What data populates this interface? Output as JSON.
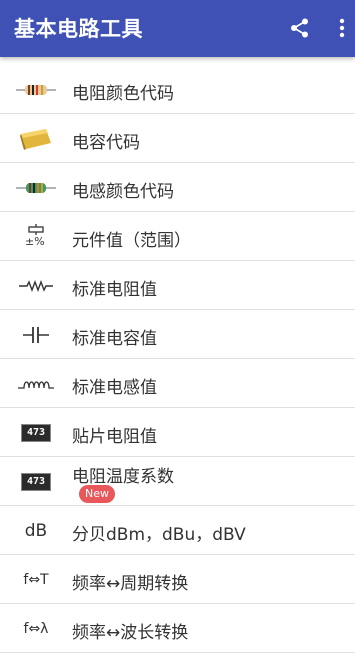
{
  "appbar": {
    "title": "基本电路工具",
    "share_icon": "share-icon",
    "more_icon": "more-vert-icon"
  },
  "menu": [
    {
      "label": "电阻颜色代码",
      "icon": "resistor-color-icon"
    },
    {
      "label": "电容代码",
      "icon": "capacitor-chip-icon"
    },
    {
      "label": "电感颜色代码",
      "icon": "inductor-color-icon"
    },
    {
      "label": "元件值（范围）",
      "icon": "tolerance-icon",
      "icon_text": "±%"
    },
    {
      "label": "标准电阻值",
      "icon": "resistor-symbol-icon"
    },
    {
      "label": "标准电容值",
      "icon": "capacitor-symbol-icon"
    },
    {
      "label": "标准电感值",
      "icon": "inductor-symbol-icon"
    },
    {
      "label": "贴片电阻值",
      "icon": "smd-resistor-icon",
      "icon_text": "473"
    },
    {
      "label": "电阻温度系数",
      "icon": "smd-resistor-icon",
      "icon_text": "473",
      "badge": "New"
    },
    {
      "label": "分贝dBm，dBu，dBV",
      "icon": "decibel-icon",
      "icon_text": "dB"
    },
    {
      "label": "频率↔周期转换",
      "icon": "frequency-period-icon",
      "icon_text": "f⇔T"
    },
    {
      "label": "频率↔波长转换",
      "icon": "frequency-wavelength-icon",
      "icon_text": "f⇔λ"
    }
  ]
}
